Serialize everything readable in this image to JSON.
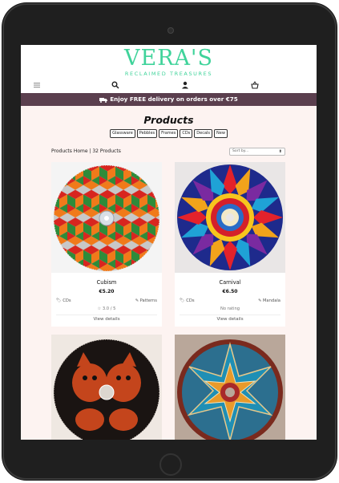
{
  "brand": {
    "name": "VERA'S",
    "tagline": "RECLAIMED TREASURES"
  },
  "icons": {
    "menu": "hamburger-icon",
    "search": "search-icon",
    "account": "user-icon",
    "basket": "basket-icon",
    "truck": "truck-icon",
    "tag": "tag-icon",
    "brush": "brush-icon",
    "star": "star-icon"
  },
  "colors": {
    "brand": "#3fd39a",
    "promo_bar": "#5b3f4e",
    "page_bg": "#fdf3f1"
  },
  "promo": {
    "text": "Enjoy FREE delivery on orders over €75"
  },
  "page": {
    "title": "Products"
  },
  "filters": [
    "Glassware",
    "Pebbles",
    "Frames",
    "CDs",
    "Decals",
    "New"
  ],
  "breadcrumb": {
    "text": "Products Home | 32 Products"
  },
  "sort": {
    "selected": "Sort by..."
  },
  "products": [
    {
      "name": "Cubism",
      "price": "€5.20",
      "category": "CDs",
      "theme": "Patterns",
      "rating": "3.0 / 5",
      "link": "View details"
    },
    {
      "name": "Carnival",
      "price": "€6.50",
      "category": "CDs",
      "theme": "Mandala",
      "rating": "No rating",
      "link": "View details"
    },
    {
      "name": "",
      "price": "",
      "category": "",
      "theme": "",
      "rating": "",
      "link": ""
    },
    {
      "name": "",
      "price": "",
      "category": "",
      "theme": "",
      "rating": "",
      "link": ""
    }
  ]
}
